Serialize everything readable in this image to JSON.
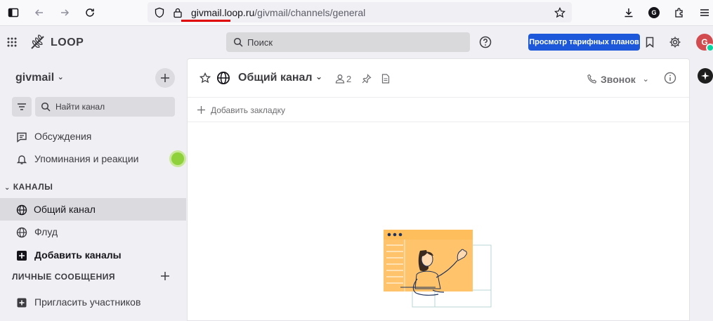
{
  "browser": {
    "url_host": "givmail.loop.ru",
    "url_path": "/givmail/channels/general",
    "profile_initial": "G"
  },
  "app": {
    "brand": "LOOP",
    "search_placeholder": "Поиск",
    "plans_button": "Просмотр тарифных планов",
    "avatar_initial": "G",
    "accent_color": "#1c58d9"
  },
  "sidebar": {
    "team_name": "givmail",
    "find_channel_placeholder": "Найти канал",
    "threads_label": "Обсуждения",
    "mentions_label": "Упоминания и реакции",
    "channels_section": "КАНАЛЫ",
    "channels": [
      {
        "label": "Общий канал",
        "icon": "globe-icon",
        "active": true
      },
      {
        "label": "Флуд",
        "icon": "globe-icon",
        "active": false
      }
    ],
    "add_channels_label": "Добавить каналы",
    "dm_section": "ЛИЧНЫЕ СООБЩЕНИЯ",
    "invite_label": "Пригласить участников"
  },
  "channel": {
    "title": "Общий канал",
    "member_count": "2",
    "call_label": "Звонок",
    "add_bookmark_label": "Добавить закладку"
  }
}
